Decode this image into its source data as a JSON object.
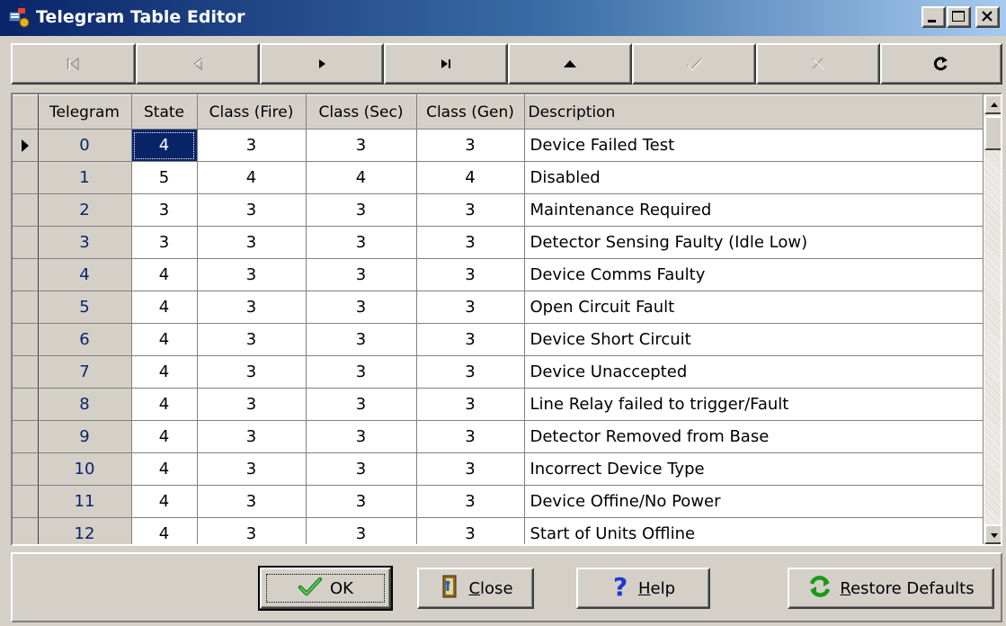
{
  "window": {
    "title": "Telegram Table Editor",
    "icon": "telegram-editor-icon"
  },
  "navigator": {
    "buttons": [
      {
        "name": "first-record",
        "icon": "first-icon",
        "enabled": false
      },
      {
        "name": "prior-record",
        "icon": "prior-icon",
        "enabled": false
      },
      {
        "name": "next-record",
        "icon": "next-icon",
        "enabled": true
      },
      {
        "name": "last-record",
        "icon": "last-icon",
        "enabled": true
      },
      {
        "name": "insert-record",
        "icon": "up-triangle-icon",
        "enabled": true
      },
      {
        "name": "post-edit",
        "icon": "check-icon",
        "enabled": false
      },
      {
        "name": "cancel-edit",
        "icon": "x-icon",
        "enabled": false
      },
      {
        "name": "refresh-data",
        "icon": "refresh-icon",
        "enabled": true
      }
    ]
  },
  "grid": {
    "columns": [
      "Telegram",
      "State",
      "Class (Fire)",
      "Class (Sec)",
      "Class (Gen)",
      "Description"
    ],
    "rows": [
      {
        "telegram": "0",
        "state": "4",
        "fire": "3",
        "sec": "3",
        "gen": "3",
        "description": "Device Failed Test"
      },
      {
        "telegram": "1",
        "state": "5",
        "fire": "4",
        "sec": "4",
        "gen": "4",
        "description": "Disabled"
      },
      {
        "telegram": "2",
        "state": "3",
        "fire": "3",
        "sec": "3",
        "gen": "3",
        "description": "Maintenance Required"
      },
      {
        "telegram": "3",
        "state": "3",
        "fire": "3",
        "sec": "3",
        "gen": "3",
        "description": "Detector Sensing Faulty (Idle Low)"
      },
      {
        "telegram": "4",
        "state": "4",
        "fire": "3",
        "sec": "3",
        "gen": "3",
        "description": "Device Comms Faulty"
      },
      {
        "telegram": "5",
        "state": "4",
        "fire": "3",
        "sec": "3",
        "gen": "3",
        "description": "Open Circuit Fault"
      },
      {
        "telegram": "6",
        "state": "4",
        "fire": "3",
        "sec": "3",
        "gen": "3",
        "description": "Device Short Circuit"
      },
      {
        "telegram": "7",
        "state": "4",
        "fire": "3",
        "sec": "3",
        "gen": "3",
        "description": "Device Unaccepted"
      },
      {
        "telegram": "8",
        "state": "4",
        "fire": "3",
        "sec": "3",
        "gen": "3",
        "description": "Line Relay failed to trigger/Fault"
      },
      {
        "telegram": "9",
        "state": "4",
        "fire": "3",
        "sec": "3",
        "gen": "3",
        "description": "Detector Removed from Base"
      },
      {
        "telegram": "10",
        "state": "4",
        "fire": "3",
        "sec": "3",
        "gen": "3",
        "description": "Incorrect Device Type"
      },
      {
        "telegram": "11",
        "state": "4",
        "fire": "3",
        "sec": "3",
        "gen": "3",
        "description": "Device Offine/No Power"
      },
      {
        "telegram": "12",
        "state": "4",
        "fire": "3",
        "sec": "3",
        "gen": "3",
        "description": "Start of Units Offline"
      }
    ],
    "selected_row": 0,
    "selected_column": "State"
  },
  "buttons": {
    "ok": {
      "label": "OK",
      "icon": "check-icon"
    },
    "close": {
      "label": "Close",
      "icon": "door-icon"
    },
    "help": {
      "label": "Help",
      "icon": "question-icon"
    },
    "restore": {
      "label": "Restore Defaults",
      "icon": "refresh-icon"
    }
  },
  "colors": {
    "face": "#d4d0c8",
    "title_start": "#0a246a",
    "title_end": "#a6caf0",
    "selection": "#0a246a",
    "telegram_text": "#0a246a"
  }
}
